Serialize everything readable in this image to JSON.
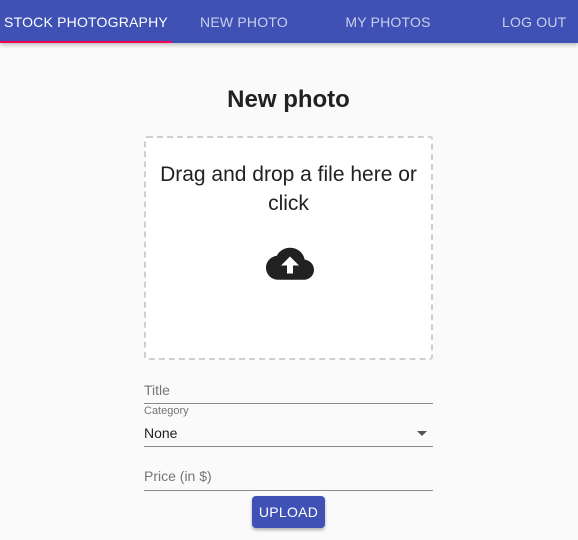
{
  "nav": {
    "tabs": [
      {
        "label": "STOCK PHOTOGRAPHY",
        "active": true
      },
      {
        "label": "NEW PHOTO",
        "active": false
      },
      {
        "label": "MY PHOTOS",
        "active": false
      },
      {
        "label": "LOG OUT",
        "active": false
      }
    ]
  },
  "colors": {
    "primary": "#3f51b5",
    "indicator": "#f50057",
    "background": "#fafafa"
  },
  "page": {
    "title": "New photo"
  },
  "dropzone": {
    "text": "Drag and drop a file here or click",
    "icon": "cloud-upload-icon"
  },
  "form": {
    "title_placeholder": "Title",
    "category_label": "Category",
    "category_value": "None",
    "price_placeholder": "Price (in $)",
    "submit_label": "UPLOAD"
  }
}
